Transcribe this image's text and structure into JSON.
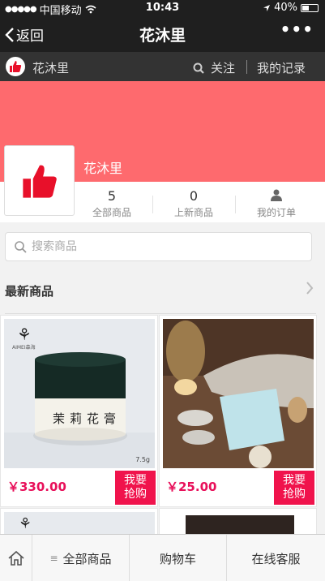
{
  "status": {
    "carrier": "中国移动",
    "time": "10:43",
    "battery": "40%"
  },
  "nav": {
    "back_label": "返回",
    "title": "花沐里"
  },
  "shop_bar": {
    "name": "花沐里",
    "follow": "关注",
    "records": "我的记录"
  },
  "shop": {
    "name": "花沐里",
    "stats": [
      {
        "value": "5",
        "label": "全部商品"
      },
      {
        "value": "0",
        "label": "上新商品"
      },
      {
        "value": "",
        "label": "我的订单"
      }
    ]
  },
  "search": {
    "placeholder": "搜索商品"
  },
  "section": {
    "title": "最新商品"
  },
  "products": [
    {
      "price": "￥330.00",
      "buy": [
        "我要",
        "抢购"
      ],
      "jar_label": "茉莉花膏",
      "weight": "7.5g",
      "brand": "AIMEI森海"
    },
    {
      "price": "￥25.00",
      "buy": [
        "我要",
        "抢购"
      ]
    }
  ],
  "tab_bar": {
    "all_goods": "全部商品",
    "cart": "购物车",
    "service": "在线客服"
  },
  "colors": {
    "banner": "#fe6a6e",
    "price": "#e8105a",
    "buy_button": "#f0134c",
    "bar_dark": "#1f1f1f"
  }
}
